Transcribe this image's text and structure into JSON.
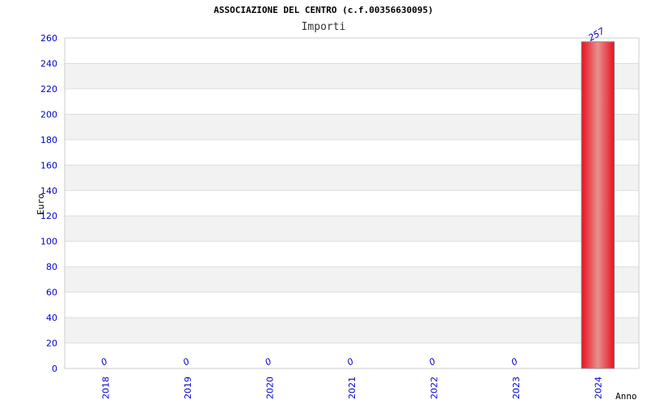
{
  "header": {
    "title": "ASSOCIAZIONE DEL CENTRO (c.f.00356630095)",
    "subtitle": "Importi"
  },
  "chart_data": {
    "type": "bar",
    "title": "ASSOCIAZIONE DEL CENTRO (c.f.00356630095)",
    "subtitle": "Importi",
    "xlabel": "Anno",
    "ylabel": "Euro",
    "categories": [
      "2018",
      "2019",
      "2020",
      "2021",
      "2022",
      "2023",
      "2024"
    ],
    "values": [
      0,
      0,
      0,
      0,
      0,
      0,
      257
    ],
    "ylim": [
      0,
      260
    ],
    "yticks": [
      0,
      20,
      40,
      60,
      80,
      100,
      120,
      140,
      160,
      180,
      200,
      220,
      240,
      260
    ],
    "grid": true,
    "bar_color": "#e8101c",
    "tick_color": "#0000cc",
    "band_color": "#f2f2f2"
  }
}
